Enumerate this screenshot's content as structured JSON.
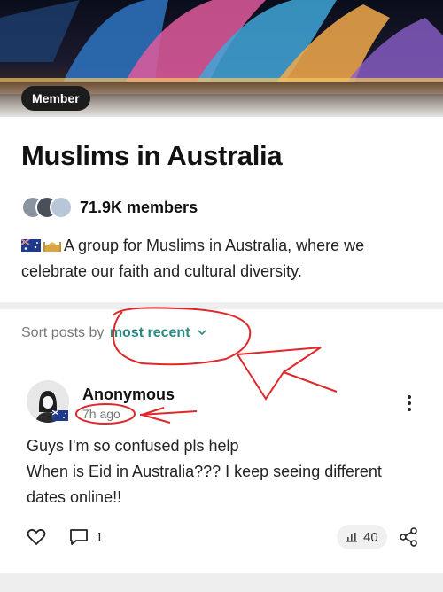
{
  "group": {
    "badge": "Member",
    "title": "Muslims in Australia",
    "members": "71.9K members",
    "description": "A group for Muslims in Australia, where we celebrate our faith and cultural diversity."
  },
  "sort": {
    "label": "Sort posts by",
    "value": "most recent"
  },
  "post": {
    "author": "Anonymous",
    "time": "7h ago",
    "body_lines": [
      "Guys I'm so confused pls help",
      "When is Eid in Australia??? I keep seeing different dates online!!"
    ],
    "comments": "1",
    "views": "40"
  },
  "colors": {
    "accent": "#2b8a82",
    "annotation": "#e0282a",
    "badge_bg": "#1c1c1c"
  },
  "icons": [
    "heart-icon",
    "comment-icon",
    "views-icon",
    "share-icon",
    "more-icon",
    "chevron-down-icon"
  ]
}
